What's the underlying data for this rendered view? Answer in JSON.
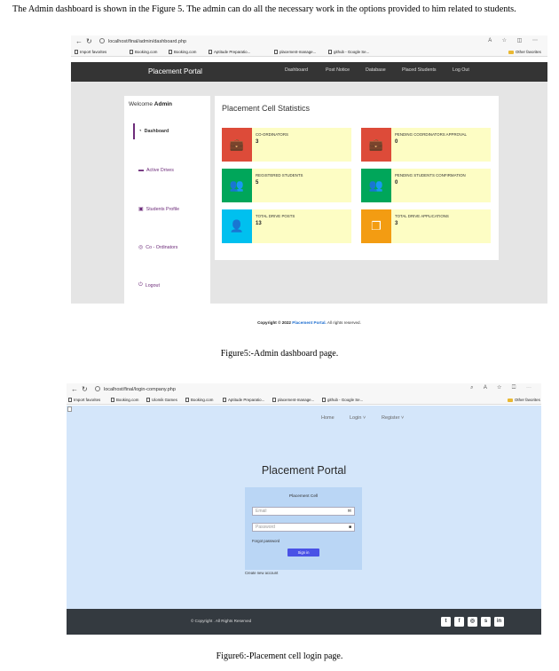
{
  "intro_text": "The Admin dashboard is shown in the Figure 5. The admin can do all the necessary work in the options provided to him related to students.",
  "figure5": {
    "caption": "Figure5:-Admin dashboard page.",
    "url": "localhost/final/admin/dashboard.php",
    "favorites": [
      "Import favorites",
      "Booking.com",
      "Booking.com",
      "Aptitude Preparatio...",
      "placement-manage...",
      "github - Google Se..."
    ],
    "other_favorites": "Other favorites",
    "nav": {
      "brand": "Placement Portal",
      "links": [
        "Dashboard",
        "Post Notice",
        "Database",
        "Placed Students",
        "Log Out"
      ]
    },
    "sidebar": {
      "welcome_prefix": "Welcome",
      "welcome_user": "Admin",
      "items": [
        "Dashboard",
        "Active Drives",
        "Students Profile",
        "Co - Ordinators",
        "Logout"
      ]
    },
    "stats_title": "Placement Cell Statistics",
    "cards": [
      {
        "label": "CO-ORDINATORS",
        "value": "3",
        "color": "#dd4b39"
      },
      {
        "label": "PENDING COORDINATORS APPROVAL",
        "value": "0",
        "color": "#dd4b39"
      },
      {
        "label": "REGISTERED STUDENTS",
        "value": "5",
        "color": "#00a65a"
      },
      {
        "label": "PENDING STUDENTS CONFIRMATION",
        "value": "0",
        "color": "#00a65a"
      },
      {
        "label": "TOTAL DRIVE POSTS",
        "value": "13",
        "color": "#00c0ef"
      },
      {
        "label": "TOTAL DRIVE APPLICATIONS",
        "value": "3",
        "color": "#f39c12"
      }
    ],
    "footer": {
      "prefix": "Copyright © 2022",
      "brand": "Placement Portal.",
      "suffix": "All rights reserved."
    }
  },
  "figure6": {
    "caption": "Figure6:-Placement cell login page.",
    "url": "localhost/final/login-company.php",
    "favorites": [
      "Import favorites",
      "Booking.com",
      "Ulomik Games",
      "Booking.com",
      "Aptitude Preparatio...",
      "placement-manage...",
      "github - Google Se..."
    ],
    "other_favorites": "Other favorites",
    "nav_links": [
      "Home",
      "Login ˅",
      "Register ˅"
    ],
    "title": "Placement Portal",
    "form": {
      "title": "Placement Cell",
      "email_placeholder": "Email",
      "password_placeholder": "Password",
      "forgot": "Forgot password",
      "submit": "Sign in",
      "create": "Create new account"
    },
    "footer_copy": "© Copyright . All Rights Reserved",
    "social_icons": [
      "twitter-icon",
      "facebook-icon",
      "instagram-icon",
      "skype-icon",
      "linkedin-icon"
    ]
  }
}
